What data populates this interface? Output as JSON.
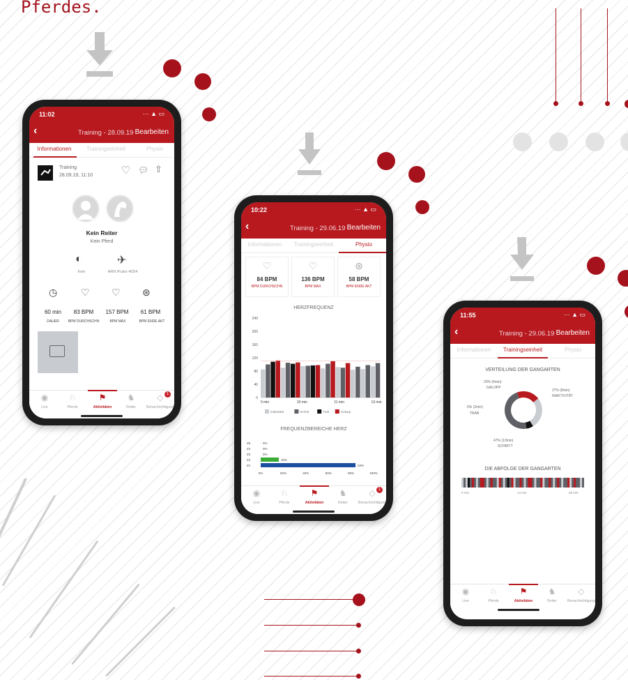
{
  "headline": "Pferdes.",
  "phone1": {
    "time": "11:02",
    "nav_title": "Training - 28.09.19",
    "edit": "Bearbeiten",
    "tabs": [
      "Informationen",
      "Trainingseinheit",
      "Physio"
    ],
    "activity_name": "Training",
    "activity_date": "28.09.19, 11:10",
    "rider_name": "Kein Reiter",
    "horse_name": "Kein Pferd",
    "device_1": "Kein",
    "device_2": "ARN iPulse 40D4",
    "stats": [
      {
        "value": "60 min",
        "label": "DAUER"
      },
      {
        "value": "83 BPM",
        "label": "BPM DURCHSCHN"
      },
      {
        "value": "157 BPM",
        "label": "BPM MAX"
      },
      {
        "value": "61 BPM",
        "label": "BPM ENDE AKT"
      }
    ]
  },
  "phone2": {
    "time": "10:22",
    "nav_title": "Training - 29.06.19",
    "edit": "Bearbeiten",
    "tabs": [
      "Informationen",
      "Trainingseinheit",
      "Physio"
    ],
    "cards": [
      {
        "value": "84 BPM",
        "label": "BPM DURCHSCHN"
      },
      {
        "value": "136 BPM",
        "label": "BPM MAX"
      },
      {
        "value": "58 BPM",
        "label": "BPM ENDE AKT"
      }
    ],
    "hr_title": "HERZFREQUENZ",
    "freq_title": "FREQUENZBEREICHE HERZ",
    "legend": [
      "Inaktivität",
      "Schritt",
      "Trab",
      "Galopp"
    ]
  },
  "phone3": {
    "time": "11:55",
    "nav_title": "Training - 29.06.19",
    "edit": "Bearbeiten",
    "tabs": [
      "Informationen",
      "Trainingseinheit",
      "Physio"
    ],
    "dist_title": "VERTEILUNG DER GANGARTEN",
    "seq_title": "DIE ABFOLGE DER GANGARTEN",
    "donut_labels": {
      "galopp_pct": "20% (6min)",
      "galopp": "GALOPP",
      "inakt_pct": "27% (8min)",
      "inakt": "INAKTIVITÄT",
      "trab_pct": "6% (2min)",
      "trab": "TRAB",
      "schritt_pct": "47% (13min)",
      "schritt": "SCHRITT"
    },
    "seq_axis": [
      "0 min",
      "14 min",
      "28 min"
    ]
  },
  "bottom_nav": [
    "Live",
    "Pferde",
    "Aktivitäten",
    "Reiter",
    "Benachrichtigungen"
  ],
  "badge_count": "1",
  "chart_data": [
    {
      "type": "bar",
      "title": "HERZFREQUENZ",
      "xlabel": "",
      "ylabel": "",
      "x_ticks": [
        "0 min",
        "10 min",
        "11 min",
        "13 min"
      ],
      "y_ticks": [
        0,
        40,
        80,
        120,
        160,
        200,
        240
      ],
      "ylim": [
        0,
        240
      ],
      "series": [
        {
          "name": "Inaktivität",
          "color": "#c9cdd2",
          "values": [
            85,
            90,
            95,
            88,
            92,
            84,
            86,
            94
          ]
        },
        {
          "name": "Schritt",
          "color": "#5f6066",
          "values": [
            100,
            105,
            96,
            102,
            90,
            93,
            98,
            104
          ]
        },
        {
          "name": "Trab",
          "color": "#111111",
          "values": [
            108,
            102,
            97
          ]
        },
        {
          "name": "Galopp",
          "color": "#b7191f",
          "values": [
            112,
            106,
            98,
            110,
            104
          ]
        }
      ],
      "legend": "bottom"
    },
    {
      "type": "bar",
      "title": "FREQUENZBEREICHE HERZ",
      "categories": [
        "Z5",
        "Z4",
        "Z3",
        "Z2",
        "Z1"
      ],
      "values": [
        0,
        0,
        0,
        16,
        84
      ],
      "value_labels": [
        "0%",
        "0%",
        "0%",
        "16%",
        "84%"
      ],
      "x_ticks": [
        "0%",
        "20%",
        "40%",
        "60%",
        "80%",
        "100%"
      ],
      "xlim": [
        0,
        100
      ],
      "orientation": "horizontal"
    },
    {
      "type": "pie",
      "title": "VERTEILUNG DER GANGARTEN",
      "categories": [
        "Galopp",
        "Inaktivität",
        "Trab",
        "Schritt"
      ],
      "values": [
        20,
        27,
        6,
        47
      ],
      "colors": [
        "#b7191f",
        "#c9cdd2",
        "#111111",
        "#5f6066"
      ]
    }
  ]
}
